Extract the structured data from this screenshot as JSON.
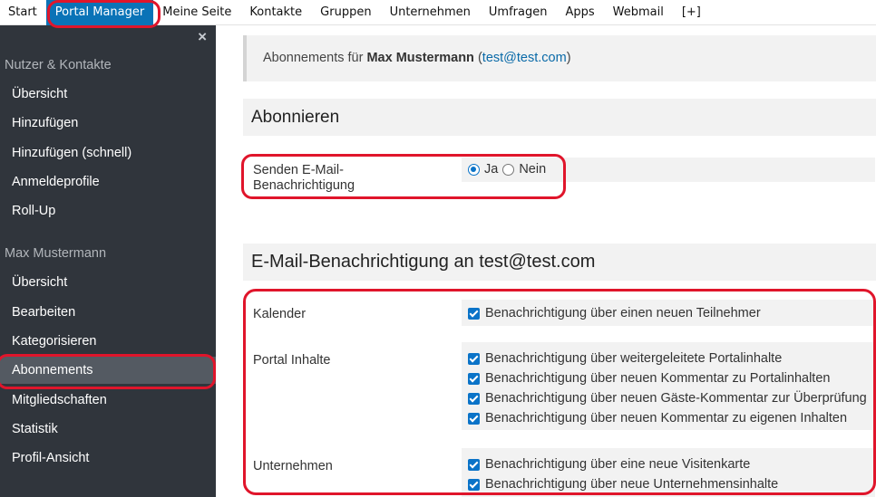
{
  "topnav": {
    "items": [
      "Start",
      "Portal Manager",
      "Meine Seite",
      "Kontakte",
      "Gruppen",
      "Unternehmen",
      "Umfragen",
      "Apps",
      "Webmail",
      "[+]"
    ],
    "active_index": 1
  },
  "sidebar": {
    "close_symbol": "×",
    "section1_title": "Nutzer & Kontakte",
    "section1_items": [
      "Übersicht",
      "Hinzufügen",
      "Hinzufügen (schnell)",
      "Anmeldeprofile",
      "Roll-Up"
    ],
    "section2_title": "Max Mustermann",
    "section2_items": [
      "Übersicht",
      "Bearbeiten",
      "Kategorisieren",
      "Abonnements",
      "Mitgliedschaften",
      "Statistik",
      "Profil-Ansicht"
    ],
    "active_item": "Abonnements"
  },
  "info": {
    "prefix": "Abonnements für",
    "name": "Max Mustermann",
    "open_paren": "(",
    "email": "test@test.com",
    "close_paren": ")"
  },
  "subscribe": {
    "heading": "Abonnieren",
    "label": "Senden E-Mail-Benachrichtigung",
    "option_yes": "Ja",
    "option_no": "Nein",
    "selected": "Ja"
  },
  "notifications": {
    "heading": "E-Mail-Benachrichtigung an test@test.com",
    "groups": [
      {
        "label": "Kalender",
        "items": [
          "Benachrichtigung über einen neuen Teilnehmer"
        ]
      },
      {
        "label": "Portal Inhalte",
        "items": [
          "Benachrichtigung über weitergeleitete Portalinhalte",
          "Benachrichtigung über neuen Kommentar zu Portalinhalten",
          "Benachrichtigung über neuen Gäste-Kommentar zur Überprüfung",
          "Benachrichtigung über neuen Kommentar zu eigenen Inhalten"
        ]
      },
      {
        "label": "Unternehmen",
        "items": [
          "Benachrichtigung über eine neue Visitenkarte",
          "Benachrichtigung über neue Unternehmensinhalte"
        ]
      }
    ]
  },
  "colors": {
    "nav_active": "#0a73b7",
    "sidebar_bg": "#30353c",
    "sidebar_active": "#545a62",
    "highlight": "#e0152b",
    "checkbox": "#0a73c8"
  }
}
